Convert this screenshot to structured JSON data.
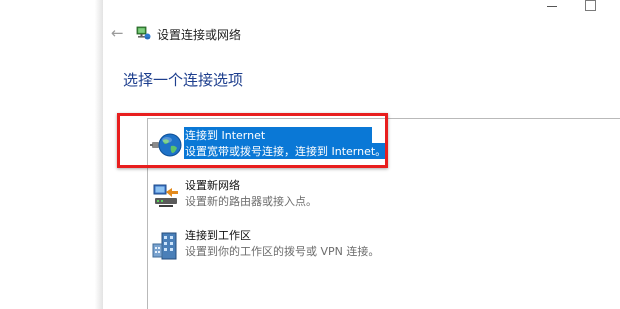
{
  "wizard": {
    "title": "设置连接或网络",
    "heading": "选择一个连接选项"
  },
  "options": [
    {
      "title": "连接到 Internet",
      "description": "设置宽带或拨号连接，连接到 Internet。",
      "icon": "globe-icon",
      "selected": true
    },
    {
      "title": "设置新网络",
      "description": "设置新的路由器或接入点。",
      "icon": "network-setup-icon",
      "selected": false
    },
    {
      "title": "连接到工作区",
      "description": "设置到你的工作区的拨号或 VPN 连接。",
      "icon": "workplace-icon",
      "selected": false
    }
  ],
  "colors": {
    "heading": "#1e3f8e",
    "selection": "#0a78d6",
    "highlight_border": "#e81e1e"
  }
}
